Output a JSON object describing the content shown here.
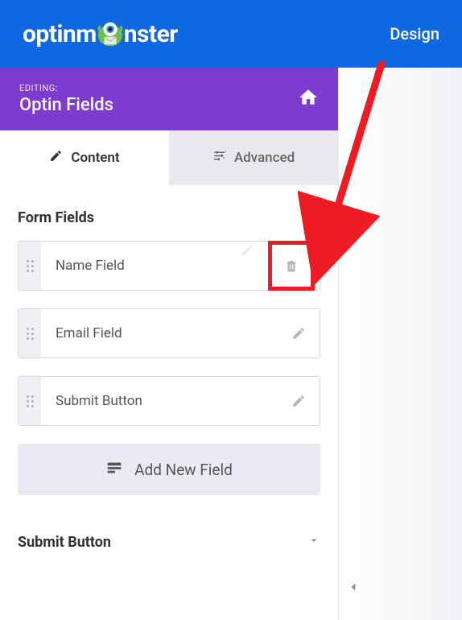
{
  "header": {
    "logo_part1": "optinm",
    "logo_part2": "nster",
    "nav_design": "Design"
  },
  "editing": {
    "label": "EDITING:",
    "title": "Optin Fields"
  },
  "tabs": {
    "content": "Content",
    "advanced": "Advanced"
  },
  "form_fields": {
    "heading": "Form Fields",
    "items": [
      {
        "label": "Name Field"
      },
      {
        "label": "Email Field"
      },
      {
        "label": "Submit Button"
      }
    ],
    "add_label": "Add New Field"
  },
  "submit_section": {
    "heading": "Submit Button"
  },
  "colors": {
    "accent_blue": "#1067e2",
    "accent_purple": "#7e3bd0",
    "highlight_red": "#ed1c24"
  }
}
